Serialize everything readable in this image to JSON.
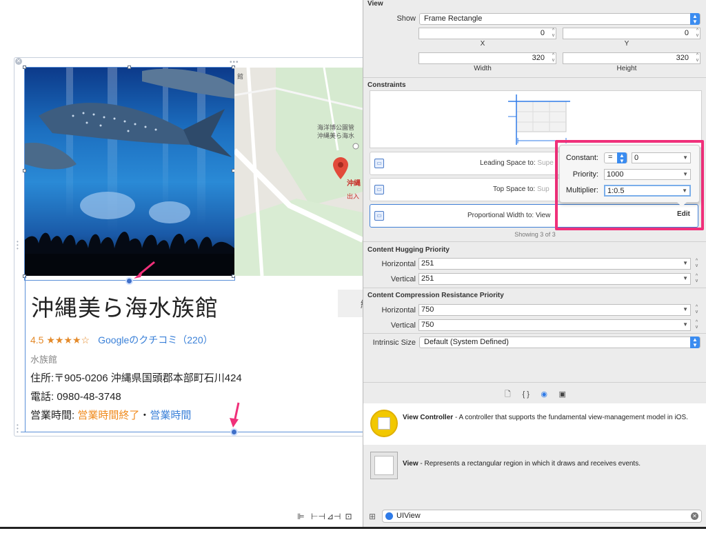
{
  "canvas": {
    "title": "沖縄美ら海水族館",
    "rating": "4.5 ★★★★☆",
    "reviews_link": "Googleのクチコミ（220）",
    "category": "水族館",
    "address_label": "住所:",
    "address_value": "〒905-0206 沖縄県国頭郡本部町石川424",
    "phone_label": "電話:",
    "phone_value": "0980-48-3748",
    "hours_label": "営業時間:",
    "hours_status": "営業時間終了",
    "hours_sep": "・",
    "hours_link": "営業時間",
    "button_partial": "経",
    "map_labels": {
      "top": "館",
      "park": "海洋博公園管",
      "park2": "沖縄美ら海水",
      "pin_label": "沖縄",
      "exit": "出入"
    }
  },
  "inspector": {
    "view_header": "View",
    "show_label": "Show",
    "show_value": "Frame Rectangle",
    "x_value": "0",
    "y_value": "0",
    "x_label": "X",
    "y_label": "Y",
    "width_value": "320",
    "height_value": "320",
    "width_label": "Width",
    "height_label": "Height",
    "constraints_header": "Constraints",
    "constraints": [
      {
        "label": "Leading Space to:",
        "target": "Supe"
      },
      {
        "label": "Top Space to:",
        "target": "Sup"
      },
      {
        "label": "Proportional Width to:",
        "target": "View"
      }
    ],
    "showing": "Showing 3 of 3",
    "hugging_header": "Content Hugging Priority",
    "hugging_horizontal_label": "Horizontal",
    "hugging_horizontal": "251",
    "hugging_vertical_label": "Vertical",
    "hugging_vertical": "251",
    "compression_header": "Content Compression Resistance Priority",
    "compression_horizontal_label": "Horizontal",
    "compression_horizontal": "750",
    "compression_vertical_label": "Vertical",
    "compression_vertical": "750",
    "intrinsic_label": "Intrinsic Size",
    "intrinsic_value": "Default (System Defined)"
  },
  "popover": {
    "constant_label": "Constant:",
    "relation": "=",
    "constant_value": "0",
    "priority_label": "Priority:",
    "priority_value": "1000",
    "multiplier_label": "Multiplier:",
    "multiplier_value": "1:0.5",
    "edit_label": "Edit"
  },
  "library": {
    "items": [
      {
        "name": "View Controller",
        "desc": " - A controller that supports the fundamental view-management model in iOS."
      },
      {
        "name": "View",
        "desc": " - Represents a rectangular region in which it draws and receives events."
      }
    ],
    "filter_value": "UIView"
  },
  "colors": {
    "highlight": "#f0307a",
    "accent": "#2f7be8",
    "rating": "#e48a2a"
  }
}
